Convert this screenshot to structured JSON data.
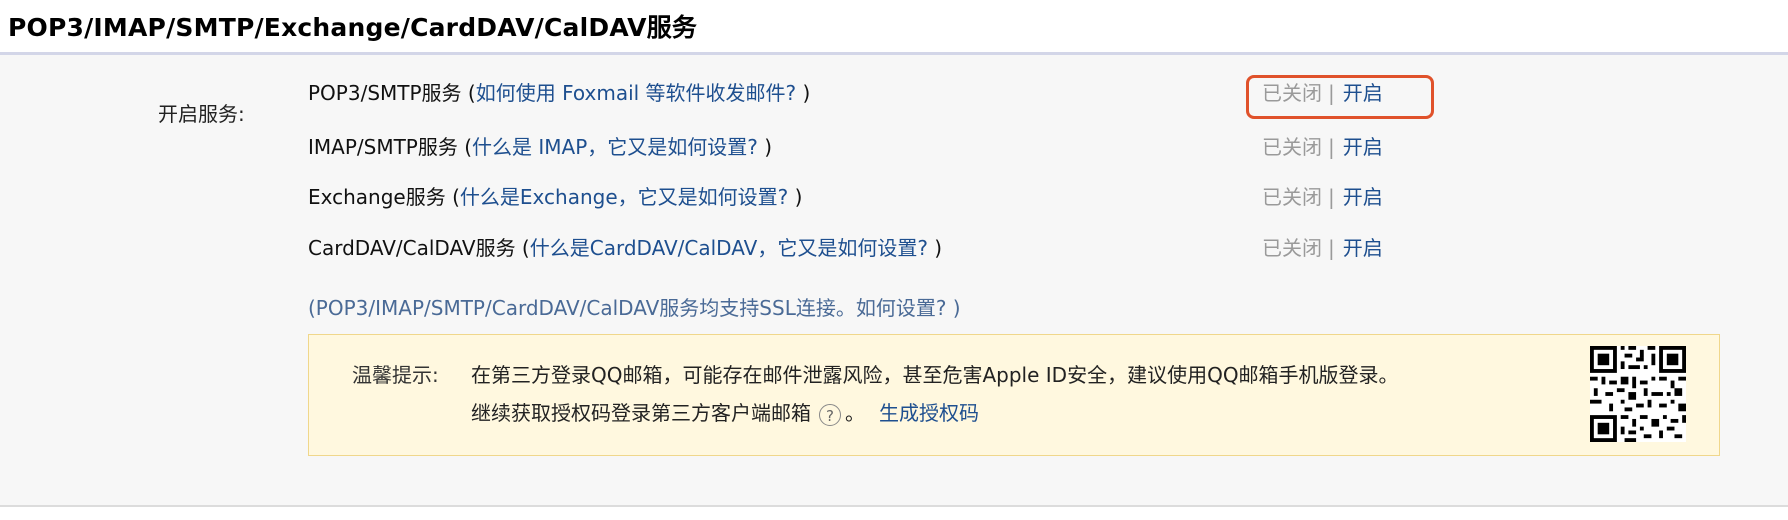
{
  "header": {
    "title": "POP3/IMAP/SMTP/Exchange/CardDAV/CalDAV服务"
  },
  "services_label": "开启服务:",
  "services": [
    {
      "name": "POP3/SMTP服务",
      "help_prefix": " (",
      "help_link": "如何使用 Foxmail 等软件收发邮件?",
      "help_suffix": " )",
      "status_off": "已关闭",
      "separator": "|",
      "action": "开启",
      "highlighted": true
    },
    {
      "name": "IMAP/SMTP服务",
      "help_prefix": " (",
      "help_link": "什么是 IMAP，它又是如何设置?",
      "help_suffix": " )",
      "status_off": "已关闭",
      "separator": "|",
      "action": "开启",
      "highlighted": false
    },
    {
      "name": "Exchange服务",
      "help_prefix": " (",
      "help_link": "什么是Exchange，它又是如何设置?",
      "help_suffix": " )",
      "status_off": "已关闭",
      "separator": "|",
      "action": "开启",
      "highlighted": false
    },
    {
      "name": "CardDAV/CalDAV服务",
      "help_prefix": " (",
      "help_link": "什么是CardDAV/CalDAV，它又是如何设置?",
      "help_suffix": " )",
      "status_off": "已关闭",
      "separator": "|",
      "action": "开启",
      "highlighted": false
    }
  ],
  "ssl_note": "(POP3/IMAP/SMTP/CardDAV/CalDAV服务均支持SSL连接。如何设置? )",
  "tip": {
    "label": "温馨提示:",
    "text1": "在第三方登录QQ邮箱，可能存在邮件泄露风险，甚至危害Apple ID安全，建议使用QQ邮箱手机版登录。",
    "text2": "继续获取授权码登录第三方客户端邮箱",
    "help_icon": "?",
    "after_icon": "。",
    "generate_link": "生成授权码",
    "qr_icon": "qr-code-icon"
  },
  "colors": {
    "link": "#1e4f8f",
    "muted": "#9a9a9a",
    "highlight": "#e0522b",
    "tip_bg": "#fff8df"
  }
}
